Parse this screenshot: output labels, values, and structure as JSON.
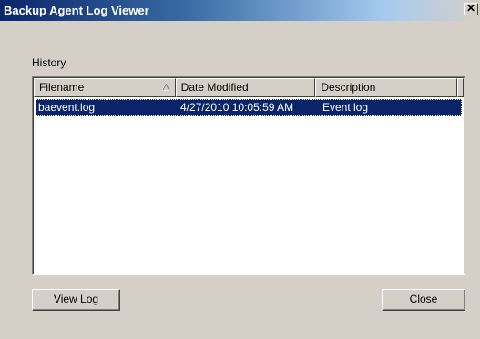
{
  "window": {
    "title": "Backup Agent Log Viewer",
    "close_glyph": "✕"
  },
  "history": {
    "label": "History",
    "columns": [
      "Filename",
      "Date Modified",
      "Description"
    ],
    "sort_column": "Filename",
    "sort_icon": "sort-ascending-icon",
    "rows": [
      {
        "filename": "baevent.log",
        "date_modified": "4/27/2010 10:05:59 AM",
        "description": "Event log",
        "selected": true
      }
    ]
  },
  "buttons": {
    "view_log_accel": "V",
    "view_log_rest": "iew Log",
    "close": "Close"
  },
  "colors": {
    "title_bar_start": "#0a246a",
    "dialog_face": "#d4d0c8",
    "selection": "#0a246a"
  }
}
